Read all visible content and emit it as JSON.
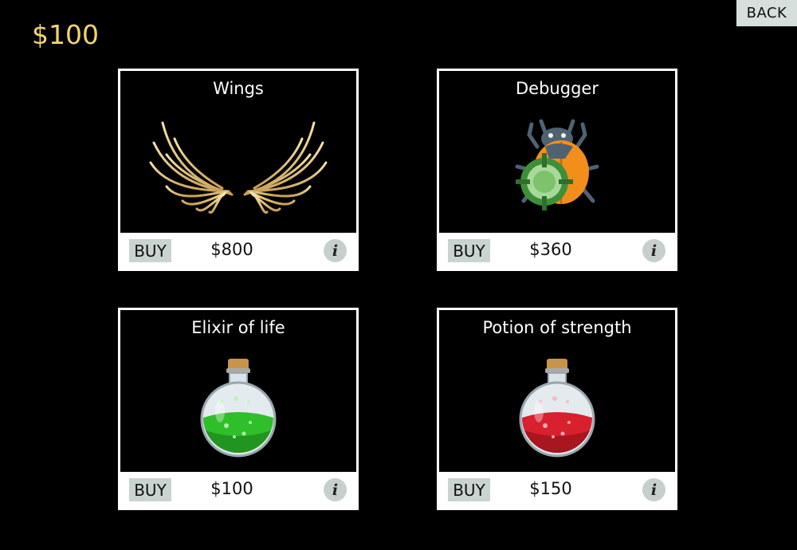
{
  "hud": {
    "money": "$100",
    "back_label": "BACK"
  },
  "colors": {
    "background": "#000000",
    "money": "#f3d66b",
    "button_bg": "#c9d3d0"
  },
  "shop": {
    "items": [
      {
        "title": "Wings",
        "buy_label": "BUY",
        "price": "$800",
        "info_label": "i",
        "icon": "wings-icon"
      },
      {
        "title": "Debugger",
        "buy_label": "BUY",
        "price": "$360",
        "info_label": "i",
        "icon": "bug-target-icon"
      },
      {
        "title": "Elixir of life",
        "buy_label": "BUY",
        "price": "$100",
        "info_label": "i",
        "icon": "green-potion-icon"
      },
      {
        "title": "Potion of strength",
        "buy_label": "BUY",
        "price": "$150",
        "info_label": "i",
        "icon": "red-potion-icon"
      }
    ]
  }
}
